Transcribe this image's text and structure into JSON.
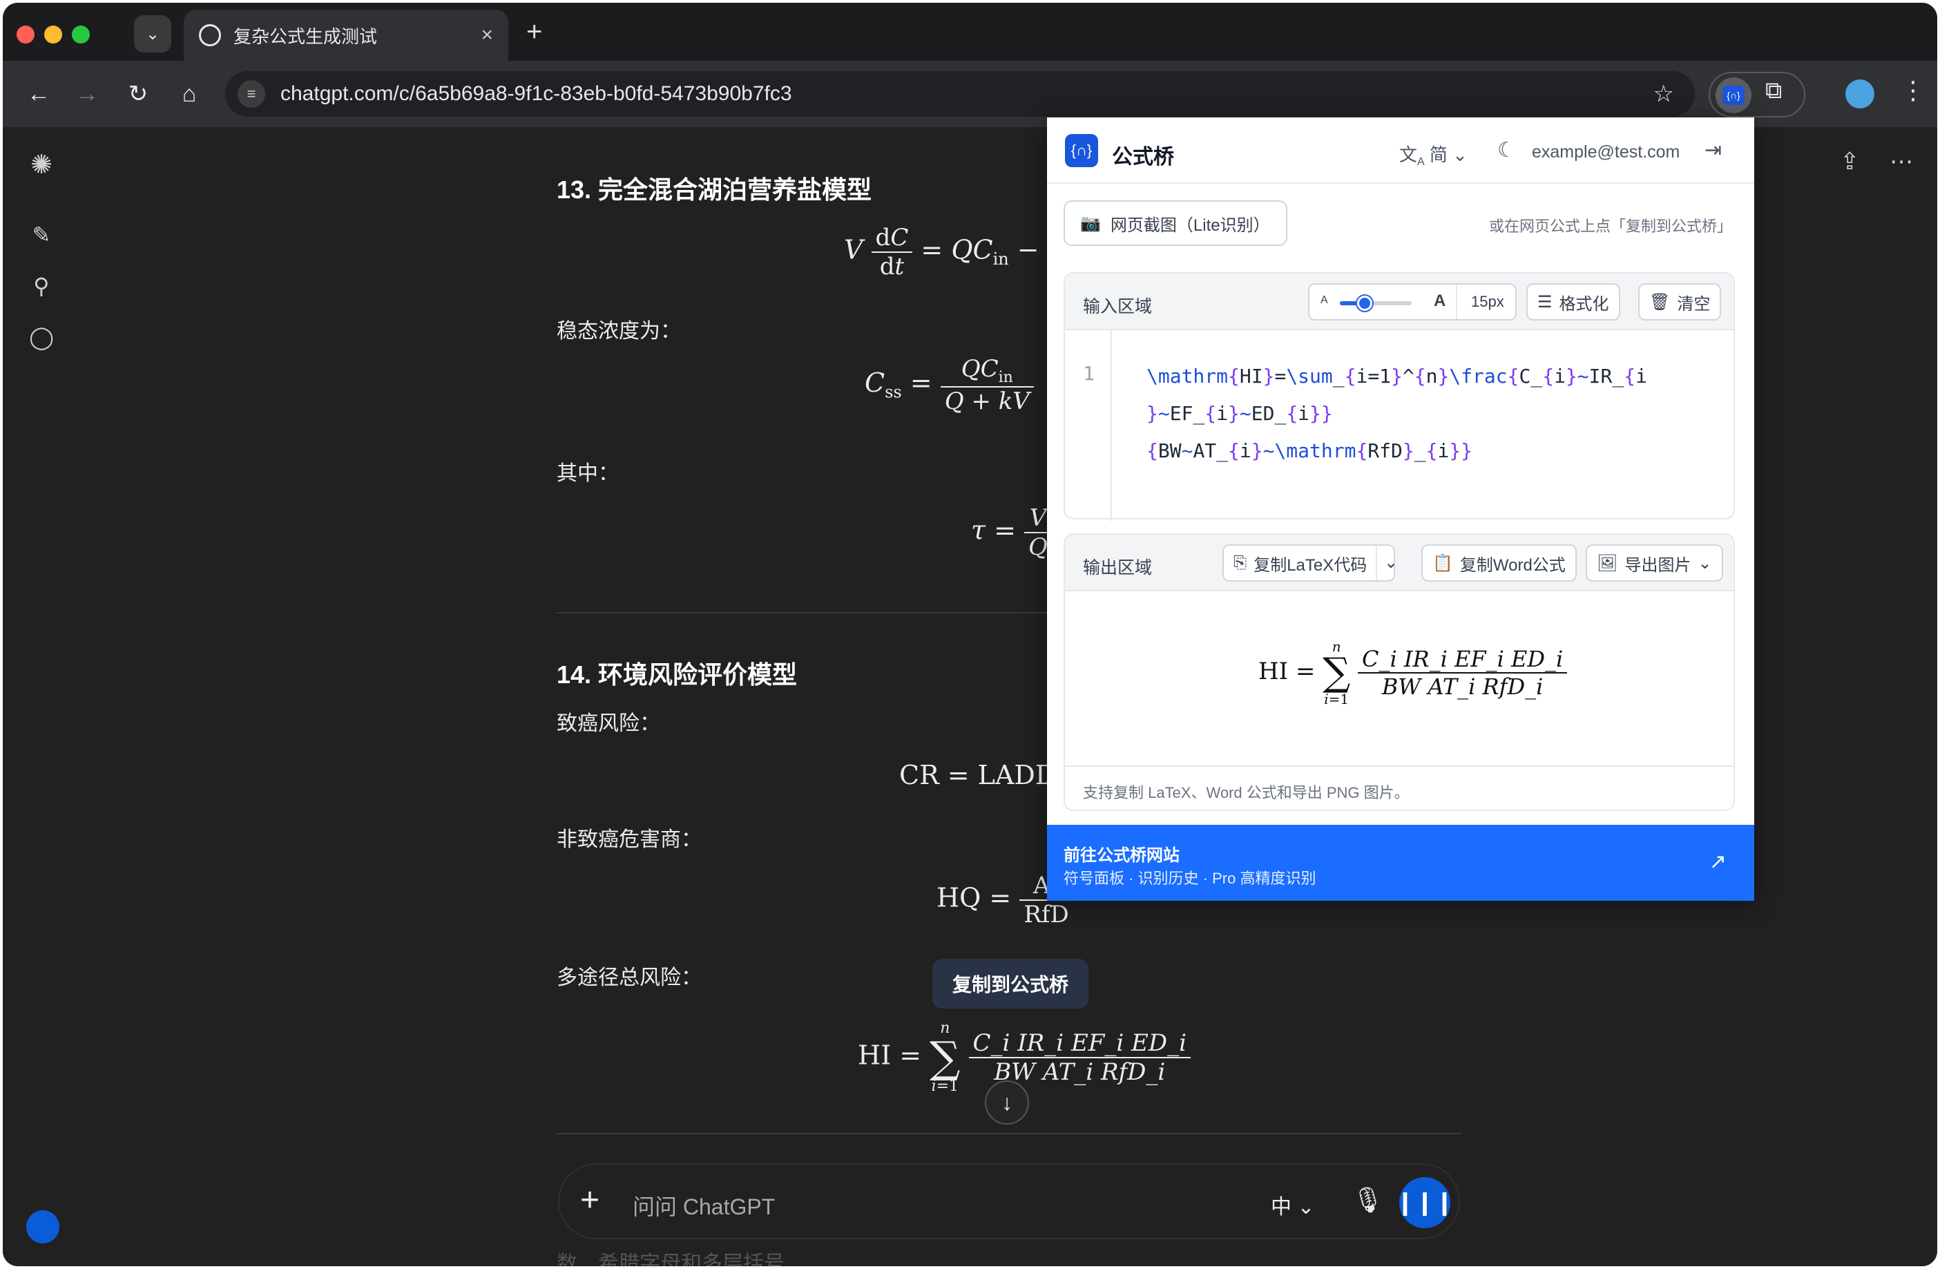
{
  "browser": {
    "tab_title": "复杂公式生成测试",
    "new_tab": "+",
    "close_tab": "×",
    "url": "chatgpt.com/c/6a5b69a8-9f1c-83eb-b0fd-5473b90b7fc3"
  },
  "chat": {
    "s13_title": "13. 完全混合湖泊营养盐模型",
    "s13_eq1": "V dC/dt = QC",
    "s13_steady": "稳态浓度为：",
    "s13_where": "其中：",
    "s14_title": "14. 环境风险评价模型",
    "carcino": "致癌风险：",
    "cr_eq": "CR = LADD",
    "noncarcino": "非致癌危害商：",
    "hq_lhs": "HQ =",
    "hq_num": "AI",
    "hq_den": "RfD",
    "multi": "多途径总风险：",
    "hi_lhs": "HI =",
    "hi_num": "C_i IR_i EF_i ED_i",
    "hi_den": "BW AT_i RfD_i",
    "tooltip": "复制到公式桥",
    "composer_placeholder": "问问 ChatGPT",
    "composer_lang": "中",
    "faded_text": "数、希腊字母和多层括号"
  },
  "popup": {
    "title": "公式桥",
    "lang": "简",
    "email": "example@test.com",
    "screenshot_btn": "网页截图（Lite识别）",
    "hint": "或在网页公式上点「复制到公式桥」",
    "input_label": "输入区域",
    "font_size": "15px",
    "slider_min_label": "A",
    "slider_max_label": "A",
    "font_scale_fraction": 0.35,
    "format_btn": "格式化",
    "clear_btn": "清空",
    "line_number": "1",
    "output_label": "输出区域",
    "copy_latex_btn": "复制LaTeX代码",
    "copy_word_btn": "复制Word公式",
    "export_img_btn": "导出图片",
    "footnote": "支持复制 LaTeX、Word 公式和导出 PNG 图片。",
    "banner_title": "前往公式桥网站",
    "banner_sub": "符号面板 · 识别历史 · Pro 高精度识别"
  },
  "colors": {
    "accent": "#1a6dff",
    "page_bg": "#212121",
    "latex_keyword": "#1d4ed8",
    "latex_brace": "#7c3aed"
  }
}
